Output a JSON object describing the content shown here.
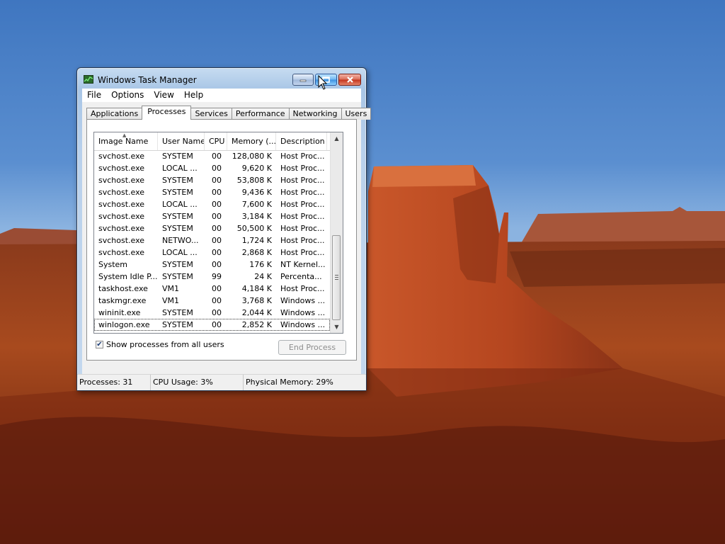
{
  "window": {
    "title": "Windows Task Manager",
    "menu": [
      "File",
      "Options",
      "View",
      "Help"
    ],
    "tabs": [
      "Applications",
      "Processes",
      "Services",
      "Performance",
      "Networking",
      "Users"
    ],
    "active_tab": "Processes"
  },
  "process_list": {
    "columns": [
      "Image Name",
      "User Name",
      "CPU",
      "Memory (...",
      "Description"
    ],
    "rows": [
      {
        "name": "svchost.exe",
        "user": "SYSTEM",
        "cpu": "00",
        "memory": "128,080 K",
        "desc": "Host Proc..."
      },
      {
        "name": "svchost.exe",
        "user": "LOCAL ...",
        "cpu": "00",
        "memory": "9,620 K",
        "desc": "Host Proc..."
      },
      {
        "name": "svchost.exe",
        "user": "SYSTEM",
        "cpu": "00",
        "memory": "53,808 K",
        "desc": "Host Proc..."
      },
      {
        "name": "svchost.exe",
        "user": "SYSTEM",
        "cpu": "00",
        "memory": "9,436 K",
        "desc": "Host Proc..."
      },
      {
        "name": "svchost.exe",
        "user": "LOCAL ...",
        "cpu": "00",
        "memory": "7,600 K",
        "desc": "Host Proc..."
      },
      {
        "name": "svchost.exe",
        "user": "SYSTEM",
        "cpu": "00",
        "memory": "3,184 K",
        "desc": "Host Proc..."
      },
      {
        "name": "svchost.exe",
        "user": "SYSTEM",
        "cpu": "00",
        "memory": "50,500 K",
        "desc": "Host Proc..."
      },
      {
        "name": "svchost.exe",
        "user": "NETWO...",
        "cpu": "00",
        "memory": "1,724 K",
        "desc": "Host Proc..."
      },
      {
        "name": "svchost.exe",
        "user": "LOCAL ...",
        "cpu": "00",
        "memory": "2,868 K",
        "desc": "Host Proc..."
      },
      {
        "name": "System",
        "user": "SYSTEM",
        "cpu": "00",
        "memory": "176 K",
        "desc": "NT Kernel..."
      },
      {
        "name": "System Idle P...",
        "user": "SYSTEM",
        "cpu": "99",
        "memory": "24 K",
        "desc": "Percenta..."
      },
      {
        "name": "taskhost.exe",
        "user": "VM1",
        "cpu": "00",
        "memory": "4,184 K",
        "desc": "Host Proc..."
      },
      {
        "name": "taskmgr.exe",
        "user": "VM1",
        "cpu": "00",
        "memory": "3,768 K",
        "desc": "Windows ..."
      },
      {
        "name": "wininit.exe",
        "user": "SYSTEM",
        "cpu": "00",
        "memory": "2,044 K",
        "desc": "Windows ..."
      },
      {
        "name": "winlogon.exe",
        "user": "SYSTEM",
        "cpu": "00",
        "memory": "2,852 K",
        "desc": "Windows ..."
      }
    ],
    "selected_row": 14
  },
  "options": {
    "show_all_label": "Show processes from all users",
    "show_all_checked": true,
    "end_process_label": "End Process"
  },
  "status": {
    "processes": "Processes: 31",
    "cpu_usage": "CPU Usage: 3%",
    "physical_memory": "Physical Memory: 29%"
  },
  "colors": {
    "sky": "#4a7fc2",
    "mesa": "#b5461f",
    "close_button": "#c3331c",
    "selected_outline": "#333333"
  },
  "icons": [
    "task-manager-icon",
    "minimize-icon",
    "maximize-icon",
    "close-icon",
    "sort-up-icon",
    "scroll-up-icon",
    "scroll-down-icon",
    "checkmark-icon",
    "mouse-cursor-icon"
  ]
}
